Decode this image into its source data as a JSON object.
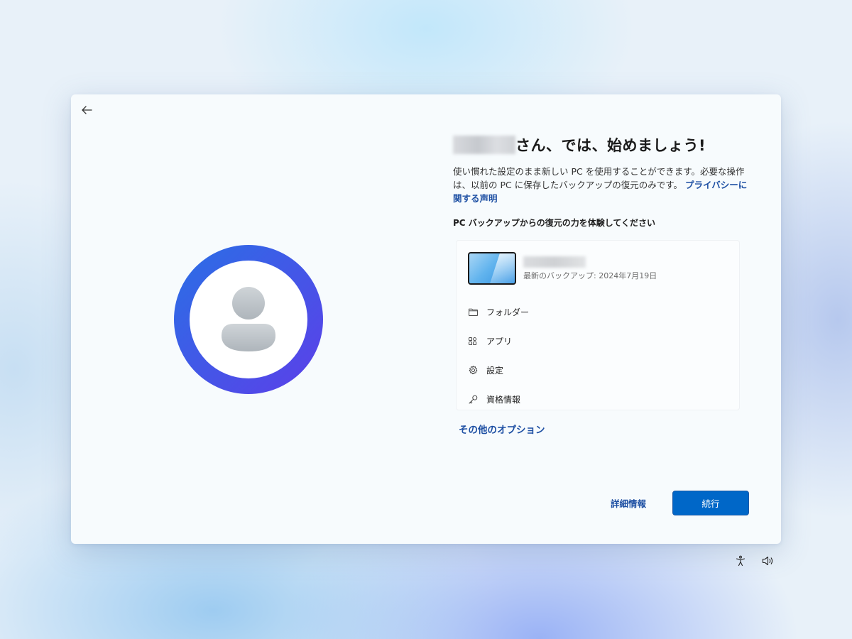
{
  "header": {
    "title_suffix": "さん、では、始めましょう!",
    "description": "使い慣れた設定のまま新しい PC を使用することができます。必要な操作は、以前の PC に保存したバックアップの復元のみです。",
    "privacy_link": "プライバシーに関する声明"
  },
  "backup": {
    "subheading": "PC バックアップからの復元の力を体験してください",
    "last_backup": "最新のバックアップ: 2024年7月19日",
    "items": [
      {
        "label": "フォルダー",
        "icon": "folder-icon"
      },
      {
        "label": "アプリ",
        "icon": "apps-icon"
      },
      {
        "label": "設定",
        "icon": "gear-icon"
      },
      {
        "label": "資格情報",
        "icon": "key-icon"
      }
    ]
  },
  "more_options": "その他のオプション",
  "footer": {
    "details_link": "詳細情報",
    "continue_button": "続行"
  },
  "colors": {
    "accent": "#0067c8",
    "link": "#1d4fa3",
    "avatar_ring_start": "#2a6fe6",
    "avatar_ring_end": "#5c3fe8"
  }
}
